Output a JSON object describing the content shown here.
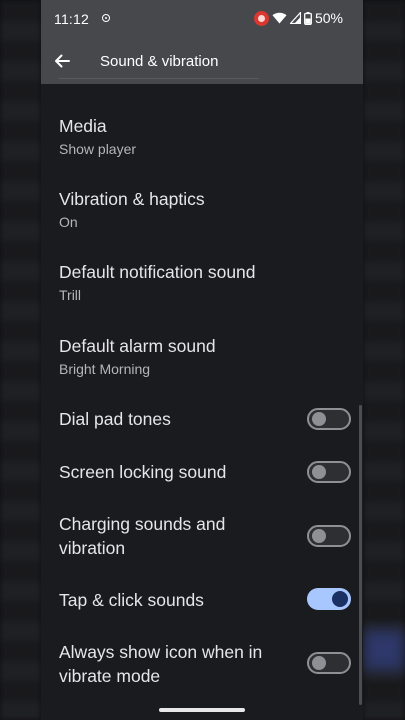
{
  "status_bar": {
    "time": "11:12",
    "battery": "50%"
  },
  "app_bar": {
    "title": "Sound & vibration"
  },
  "settings": {
    "items": [
      {
        "title": "Media",
        "summary": "Show player"
      },
      {
        "title": "Vibration & haptics",
        "summary": "On"
      },
      {
        "title": "Default notification sound",
        "summary": "Trill"
      },
      {
        "title": "Default alarm sound",
        "summary": "Bright Morning"
      }
    ],
    "toggles": [
      {
        "title": "Dial pad tones",
        "checked": false
      },
      {
        "title": "Screen locking sound",
        "checked": false
      },
      {
        "title": "Charging sounds and vibration",
        "checked": false
      },
      {
        "title": "Tap & click sounds",
        "checked": true
      },
      {
        "title": "Always show icon when in vibrate mode",
        "checked": false
      }
    ]
  },
  "colors": {
    "toggle_on_track": "#a9c7ff",
    "toggle_on_knob": "#1b3063",
    "app_bar": "#46484c",
    "background": "#1a1b1e"
  },
  "icons": {
    "back": "arrow-left-icon",
    "screen_record": "screen-record-icon",
    "location": "location-target-icon",
    "wifi": "wifi-icon",
    "signal": "cell-signal-icon",
    "battery": "battery-icon"
  }
}
